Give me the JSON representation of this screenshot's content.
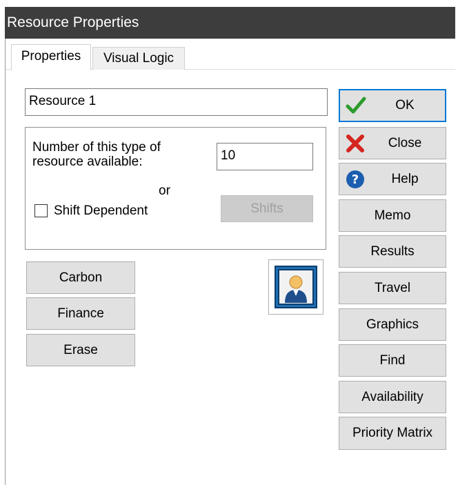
{
  "window": {
    "title": "Resource Properties"
  },
  "tabs": [
    {
      "label": "Properties",
      "active": true
    },
    {
      "label": "Visual Logic",
      "active": false
    }
  ],
  "name_field": {
    "value": "Resource 1"
  },
  "availability_group": {
    "number_label": "Number of this type of resource available:",
    "number_value": "10",
    "or_label": "or",
    "shift_dependent_label": "Shift Dependent",
    "shift_dependent_checked": false,
    "shifts_button": "Shifts"
  },
  "left_buttons": [
    "Carbon",
    "Finance",
    "Erase"
  ],
  "side_buttons": {
    "ok": "OK",
    "close": "Close",
    "help": "Help",
    "memo": "Memo",
    "results": "Results",
    "travel": "Travel",
    "graphics": "Graphics",
    "find": "Find",
    "availability": "Availability",
    "priority_matrix": "Priority Matrix"
  },
  "icons": {
    "ok": "checkmark-icon",
    "close": "red-x-icon",
    "help": "question-icon",
    "resource_image": "person-icon"
  },
  "colors": {
    "titlebar": "#3d3d3d",
    "button_face": "#e1e1e1",
    "default_border": "#0078d7"
  }
}
